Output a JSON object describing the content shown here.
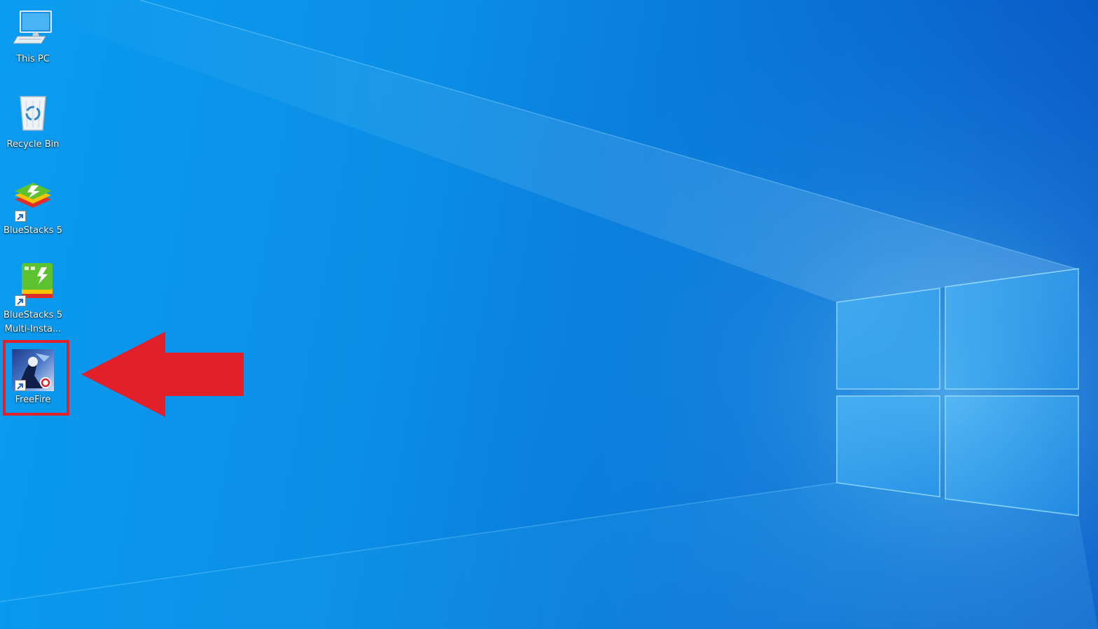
{
  "desktop": {
    "icons": [
      {
        "label": "This PC",
        "icon": "computer-icon"
      },
      {
        "label": "Recycle Bin",
        "icon": "recycle-bin-icon"
      },
      {
        "label": "BlueStacks 5",
        "icon": "bluestacks-icon"
      },
      {
        "label": "BlueStacks 5 Multi-Insta...",
        "label_line1": "BlueStacks 5",
        "label_line2": "Multi-Insta...",
        "icon": "bluestacks-multi-instance-icon"
      },
      {
        "label": "FreeFire",
        "icon": "freefire-icon"
      }
    ],
    "highlighted_icon": "FreeFire"
  },
  "colors": {
    "annotation_red": "#e2202a",
    "wallpaper_blue": "#0a8fe6",
    "label_text": "#ffffff"
  }
}
